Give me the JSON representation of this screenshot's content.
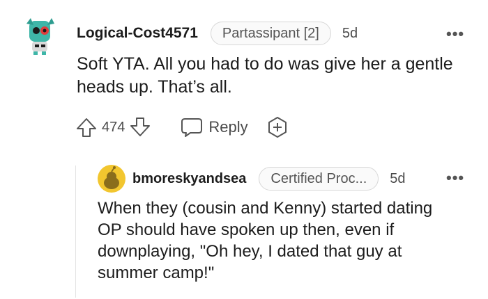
{
  "comment": {
    "username": "Logical-Cost4571",
    "flair": "Partassipant [2]",
    "age": "5d",
    "body": "Soft YTA. All you had to do was give her a gentle heads up. That’s all.",
    "votes": "474",
    "reply_label": "Reply",
    "more_label": "•••"
  },
  "reply": {
    "username": "bmoreskyandsea",
    "flair": "Certified Proc...",
    "age": "5d",
    "body": "When they (cousin and Kenny) started dating OP should have spoken up then, even if downplaying, \"Oh hey, I dated that guy at summer camp!\"",
    "more_label": "•••"
  },
  "colors": {
    "avatar_top": "#3fb6a8",
    "avatar_reply": "#f2c62f",
    "icon_stroke": "#555555"
  },
  "icons": [
    "upvote-icon",
    "downvote-icon",
    "reply-bubble-icon",
    "award-plus-icon",
    "more-options-icon"
  ]
}
